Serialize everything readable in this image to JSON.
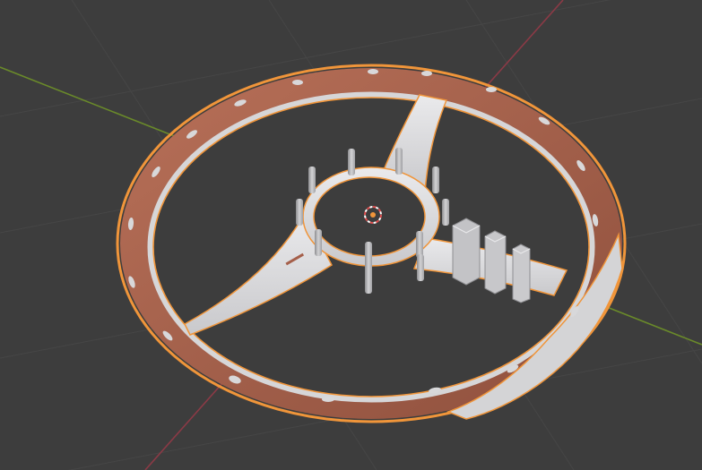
{
  "viewport": {
    "mode": "3d-viewport",
    "background_color": "#3d3d3d",
    "grid_color": "#474747",
    "x_axis_color": "#8b3a46",
    "y_axis_color": "#6a8a2a",
    "selection_outline_color": "#f0953a",
    "object_base_color": "#d6d6d8",
    "wood_color": "#a55f4a"
  },
  "scene": {
    "selected_object": "steering-wheel",
    "origin_marker": "object-origin-icon",
    "cursor_marker": "3d-cursor-icon"
  }
}
